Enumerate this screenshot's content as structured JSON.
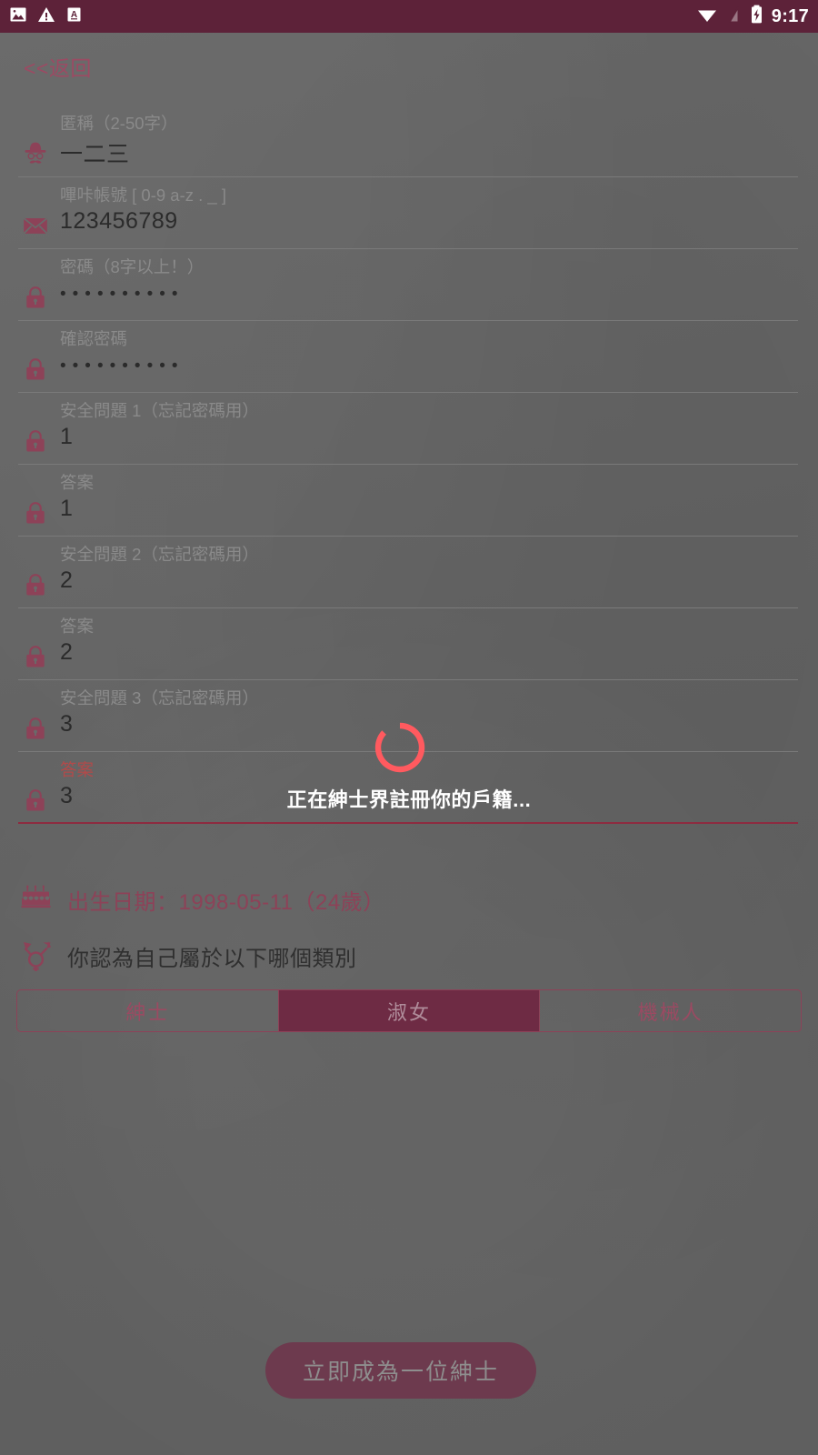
{
  "status_bar": {
    "icons_left": [
      "image-icon",
      "warning-triangle-icon",
      "font-size-a-icon"
    ],
    "icons_right": [
      "wifi-icon",
      "no-signal-icon",
      "battery-charging-icon"
    ],
    "time": "9:17",
    "background_color": "#5d2239"
  },
  "nav": {
    "back_label": "<<返回"
  },
  "theme": {
    "accent": "#8d4258",
    "brand_dark": "#5d2239",
    "spinner_color": "#ff5a5f",
    "error_color": "#b24a4a"
  },
  "form": {
    "fields": [
      {
        "name": "nickname",
        "label": "匿稱（2-50字）",
        "value": "一二三",
        "icon": "gentleman-hat-icon",
        "focused": false,
        "masked": false
      },
      {
        "name": "account",
        "label": "嗶咔帳號 [ 0-9 a-z . _ ]",
        "value": "123456789",
        "icon": "envelope-icon",
        "focused": false,
        "masked": false
      },
      {
        "name": "password",
        "label": "密碼（8字以上！）",
        "value": "••••••••••",
        "icon": "lock-icon",
        "focused": false,
        "masked": true
      },
      {
        "name": "confirm-password",
        "label": "確認密碼",
        "value": "••••••••••",
        "icon": "lock-icon",
        "focused": false,
        "masked": true
      },
      {
        "name": "security-question-1",
        "label": "安全問題 1（忘記密碼用）",
        "value": "1",
        "icon": "lock-icon",
        "focused": false,
        "masked": false
      },
      {
        "name": "security-answer-1",
        "label": "答案",
        "value": "1",
        "icon": "lock-icon",
        "focused": false,
        "masked": false
      },
      {
        "name": "security-question-2",
        "label": "安全問題 2（忘記密碼用）",
        "value": "2",
        "icon": "lock-icon",
        "focused": false,
        "masked": false
      },
      {
        "name": "security-answer-2",
        "label": "答案",
        "value": "2",
        "icon": "lock-icon",
        "focused": false,
        "masked": false
      },
      {
        "name": "security-question-3",
        "label": "安全問題 3（忘記密碼用）",
        "value": "3",
        "icon": "lock-icon",
        "focused": false,
        "masked": false
      },
      {
        "name": "security-answer-3",
        "label": "答案",
        "value": "3",
        "icon": "lock-icon",
        "focused": true,
        "masked": false
      }
    ]
  },
  "birthday": {
    "icon": "birthday-cake-icon",
    "text": "出生日期：1998-05-11（24歲）"
  },
  "gender": {
    "icon": "transgender-icon",
    "prompt": "你認為自己屬於以下哪個類別",
    "options": [
      {
        "label": "紳士",
        "selected": false
      },
      {
        "label": "淑女",
        "selected": true
      },
      {
        "label": "機械人",
        "selected": false
      }
    ]
  },
  "submit": {
    "label": "立即成為一位紳士"
  },
  "loading": {
    "text": "正在紳士界註冊你的戶籍...",
    "spinner": "loading-spinner-icon"
  }
}
